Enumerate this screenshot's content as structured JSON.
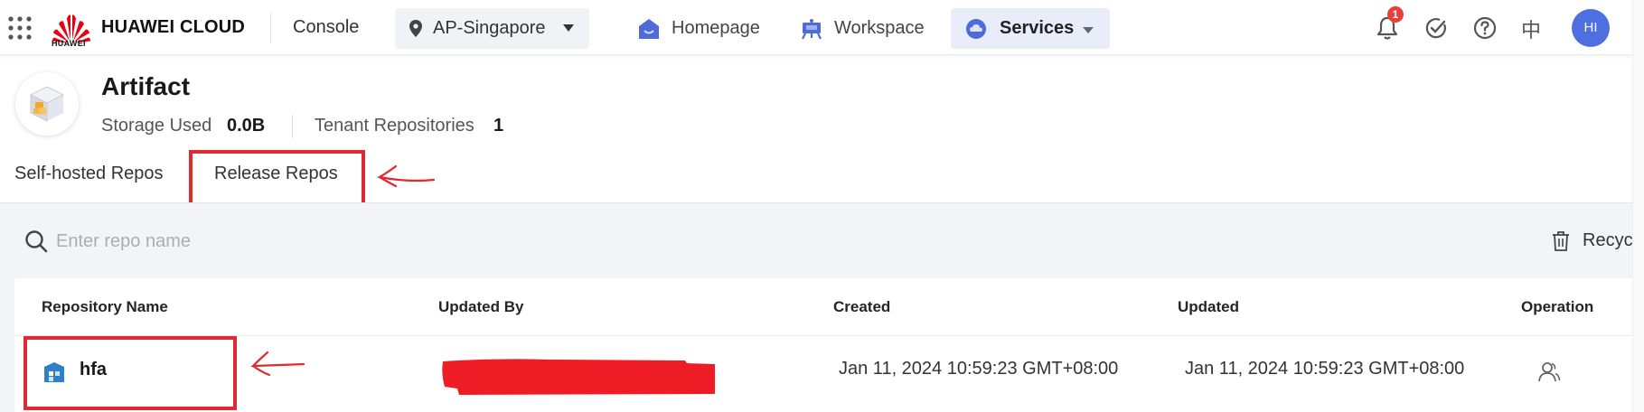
{
  "topbar": {
    "brand": "HUAWEI CLOUD",
    "logo_subtext": "HUAWEI",
    "console_label": "Console",
    "region": "AP-Singapore",
    "nav": {
      "homepage": "Homepage",
      "workspace": "Workspace",
      "services": "Services"
    },
    "notification_count": "1",
    "language_label": "中",
    "avatar_initials": "HI"
  },
  "service": {
    "title": "Artifact",
    "storage_used_label": "Storage Used",
    "storage_used_value": "0.0B",
    "tenant_repos_label": "Tenant Repositories",
    "tenant_repos_value": "1"
  },
  "tabs": [
    {
      "label": "Self-hosted Repos",
      "active": false
    },
    {
      "label": "Release Repos",
      "active": true
    }
  ],
  "search": {
    "placeholder": "Enter repo name",
    "value": ""
  },
  "recycle_label": "Recyc",
  "table": {
    "columns": [
      "Repository Name",
      "Updated By",
      "Created",
      "Updated",
      "Operation"
    ],
    "rows": [
      {
        "name": "hfa",
        "updated_by": "",
        "created": "Jan 11, 2024 10:59:23 GMT+08:00",
        "updated": "Jan 11, 2024 10:59:23 GMT+08:00"
      }
    ]
  },
  "colors": {
    "annotation_red": "#e02a2f",
    "accent_blue": "#4e6fe0",
    "services_highlight": "#e8edf9",
    "content_bg": "#f3f4f7",
    "badge_red": "#e8413a"
  },
  "icons": [
    "grid-menu-icon",
    "huawei-logo-icon",
    "location-pin-icon",
    "home-icon",
    "workspace-icon",
    "services-cloud-icon",
    "bell-icon",
    "check-circle-icon",
    "help-icon",
    "artifact-box-icon",
    "search-icon",
    "trash-icon",
    "repo-icon",
    "member-icon"
  ]
}
